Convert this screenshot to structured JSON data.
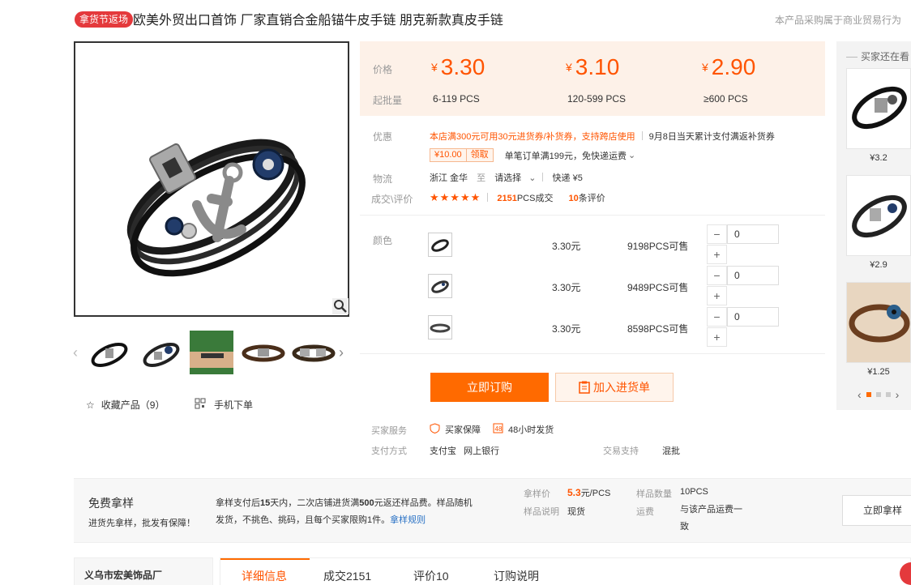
{
  "header": {
    "badge": "拿货节返场",
    "title": "欧美外贸出口首饰 厂家直销合金船锚牛皮手链 朋克新款真皮手链",
    "note": "本产品采购属于商业贸易行为"
  },
  "gallery": {
    "thumb_count": 5,
    "favorite_label": "收藏产品（9）",
    "mobile_label": "手机下单"
  },
  "price_box": {
    "price_label": "价格",
    "qty_label": "起批量",
    "currency": "¥",
    "tiers": [
      {
        "price": "3.30",
        "qty": "6-119 PCS"
      },
      {
        "price": "3.10",
        "qty": "120-599 PCS"
      },
      {
        "price": "2.90",
        "qty": "≥600 PCS"
      }
    ]
  },
  "promo": {
    "label": "优惠",
    "line1": "本店满300元可用30元进货券/补货券，支持跨店使用",
    "line1_extra": "9月8日当天累计支付满返补货券",
    "coupon_value": "¥10.00",
    "coupon_get": "领取",
    "coupon_desc": "单笔订单满199元，免快递运费"
  },
  "logistics": {
    "label": "物流",
    "from": "浙江 金华",
    "to": "至",
    "select": "请选择",
    "express": "快递 ¥5"
  },
  "deals": {
    "label": "成交\\评价",
    "stars": "★★★★★",
    "deal_count": "2151",
    "deal_suffix": "PCS成交",
    "review_count": "10",
    "review_suffix": "条评价"
  },
  "sku": {
    "label": "颜色",
    "rows": [
      {
        "price": "3.30元",
        "stock": "9198PCS可售",
        "qty": "0"
      },
      {
        "price": "3.30元",
        "stock": "9489PCS可售",
        "qty": "0"
      },
      {
        "price": "3.30元",
        "stock": "8598PCS可售",
        "qty": "0"
      }
    ],
    "minus": "−",
    "plus": "+"
  },
  "actions": {
    "order": "立即订购",
    "cart": "加入进货单"
  },
  "service": {
    "buyer_label": "买家服务",
    "protect": "买家保障",
    "ship48": "48小时发货",
    "pay_label": "支付方式",
    "pay_values": "支付宝   网上银行",
    "trade_label": "交易支持",
    "trade_value": "混批"
  },
  "recommend": {
    "title": "买家还在看",
    "items": [
      {
        "price": "¥3.2"
      },
      {
        "price": "¥2.9"
      },
      {
        "price": "¥1.25"
      }
    ],
    "prev": "‹",
    "next": "›"
  },
  "sample": {
    "title": "免费拿样",
    "subtitle": "进货先拿样，批发有保障！",
    "desc_pre": "拿样支付后",
    "desc_days": "15",
    "desc_mid": "天内，二次店铺进货满",
    "desc_amt": "500",
    "desc_post": "元返还样品费。样品随机发货，不挑色、挑码，且每个买家限购1件。",
    "rule_link": "拿样规则",
    "price_label": "拿样价",
    "price_value": "5.3",
    "price_unit": "元/PCS",
    "info_label": "样品说明",
    "info_value": "现货",
    "count_label": "样品数量",
    "count_value": "10PCS",
    "freight_label": "运费",
    "freight_value": "与该产品运费一致",
    "button": "立即拿样"
  },
  "bottom": {
    "shop_name": "义乌市宏美饰品厂",
    "tabs": [
      "详细信息",
      "成交2151",
      "评价10",
      "订购说明"
    ]
  },
  "colors": {
    "accent": "#ff6a00",
    "price": "#ff5400",
    "badge": "#e4393c"
  }
}
